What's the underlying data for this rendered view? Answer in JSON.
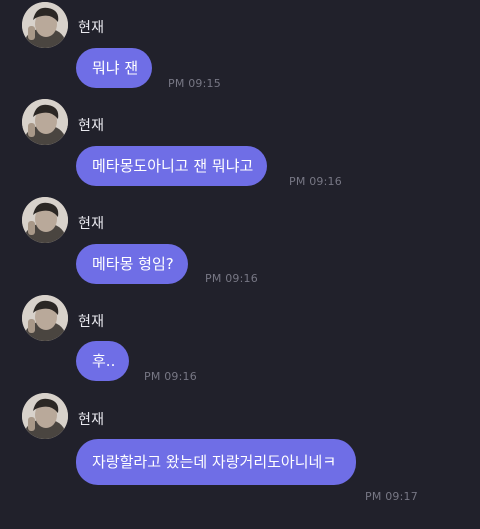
{
  "messages": [
    {
      "sender": "현재",
      "text": "뭐냐 잰",
      "time": "PM 09:15"
    },
    {
      "sender": "현재",
      "text": "메타몽도아니고 잰 뭐냐고",
      "time": "PM 09:16"
    },
    {
      "sender": "현재",
      "text": "메타몽 형임?",
      "time": "PM 09:16"
    },
    {
      "sender": "현재",
      "text": "후..",
      "time": "PM 09:16"
    },
    {
      "sender": "현재",
      "text": "자랑할라고 왔는데 자랑거리도아니네ㅋ",
      "time": "PM 09:17"
    }
  ],
  "colors": {
    "background": "#21212b",
    "bubble": "#6f6ee6",
    "bubble_text": "#ffffff",
    "timestamp": "#777784",
    "name": "#e8e8ee"
  },
  "icons": {
    "avatar": "profile-photo"
  }
}
